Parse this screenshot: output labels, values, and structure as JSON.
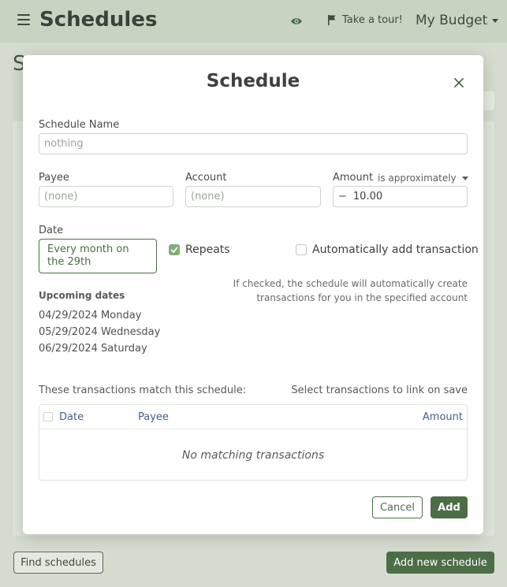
{
  "header": {
    "title": "Schedules",
    "tour_label": "Take a tour!",
    "budget_label": "My Budget",
    "icons": {
      "menu": "hamburger-icon",
      "eye": "eye-icon",
      "tour": "flag-icon",
      "budget": "chevron-down-icon"
    }
  },
  "background": {
    "title_fragment": "S",
    "find_button": "Find schedules",
    "add_button": "Add new schedule"
  },
  "modal": {
    "title": "Schedule",
    "name_label": "Schedule Name",
    "name_value": "nothing",
    "payee_label": "Payee",
    "payee_value": "(none)",
    "account_label": "Account",
    "account_value": "(none)",
    "amount_label": "Amount",
    "amount_mode": "is approximately",
    "amount_sign": "−",
    "amount_value": "10.00",
    "date_label": "Date",
    "date_value": "Every month on the 29th",
    "repeats_label": "Repeats",
    "repeats_checked": true,
    "auto_add_label": "Automatically add transaction",
    "auto_add_checked": false,
    "auto_add_hint": "If checked, the schedule will automatically create transactions for you in the specified account",
    "upcoming_title": "Upcoming dates",
    "upcoming_dates": [
      "04/29/2024 Monday",
      "05/29/2024 Wednesday",
      "06/29/2024 Saturday"
    ],
    "match_label": "These transactions match this schedule:",
    "link_label": "Select transactions to link on save",
    "table": {
      "columns": [
        "Date",
        "Payee",
        "Amount"
      ],
      "empty_text": "No matching transactions"
    },
    "cancel_label": "Cancel",
    "add_label": "Add"
  },
  "colors": {
    "accent": "#4d6d47",
    "header_bg": "#c9d3c2",
    "check_on": "#7fae74",
    "table_header_text": "#46608a"
  }
}
